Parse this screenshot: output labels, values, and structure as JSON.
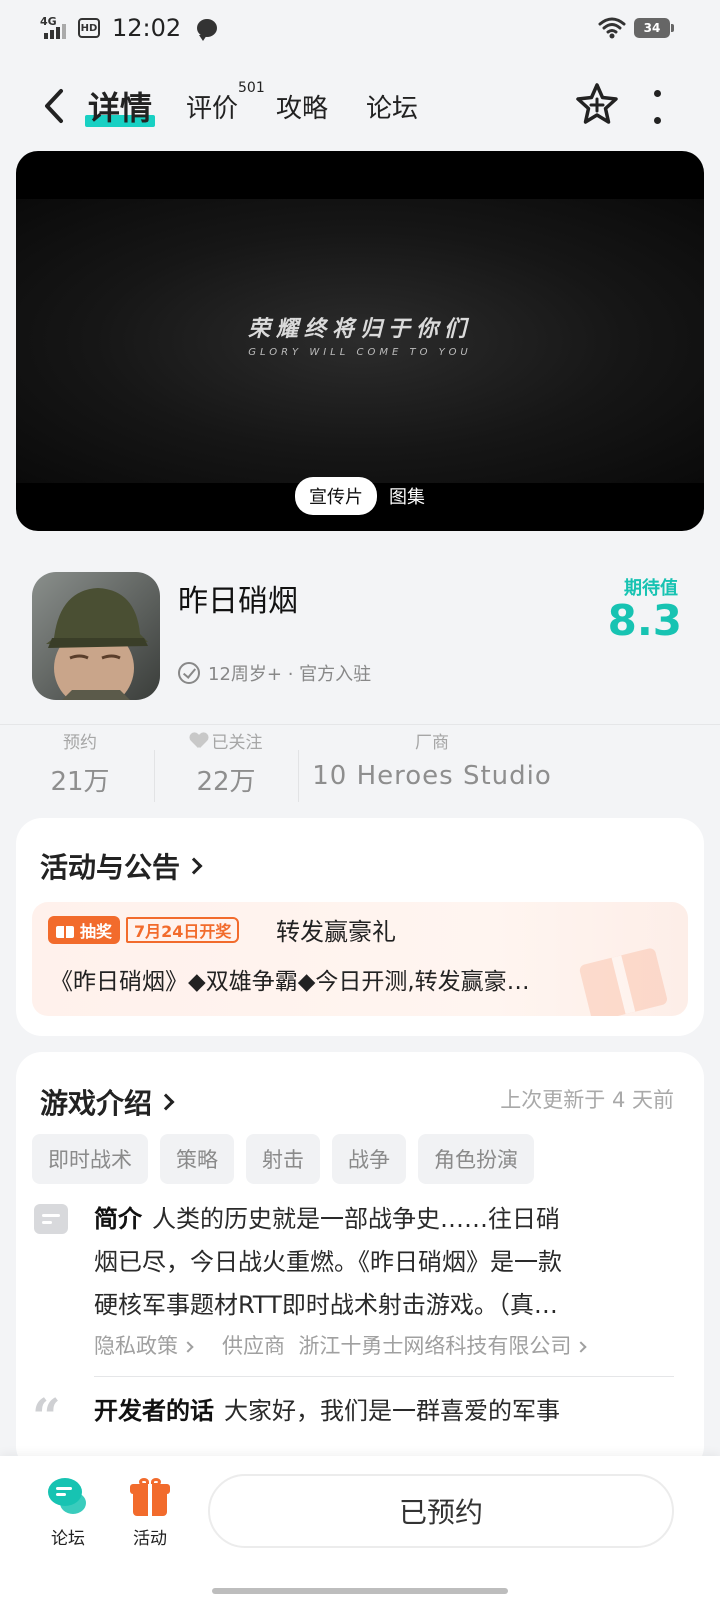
{
  "status_bar": {
    "network": "4G",
    "hd": "HD",
    "time": "12:02",
    "battery": "34"
  },
  "nav": {
    "tabs": [
      {
        "label": "详情",
        "active": true
      },
      {
        "label": "评价",
        "badge": "501"
      },
      {
        "label": "攻略"
      },
      {
        "label": "论坛"
      }
    ]
  },
  "hero": {
    "slogan": "荣耀终将归于你们",
    "slogan_en": "GLORY WILL COME TO YOU",
    "tabs": [
      "宣传片",
      "图集"
    ]
  },
  "app": {
    "name": "昨日硝烟",
    "meta": "12周岁+ · 官方入驻",
    "expect_label": "期待值",
    "expect_value": "8.3"
  },
  "stats": {
    "reserve": {
      "label": "预约",
      "value": "21万"
    },
    "follow": {
      "label": "已关注",
      "value": "22万"
    },
    "vendor": {
      "label": "厂商",
      "value": "10 Heroes Studio"
    }
  },
  "activity": {
    "title": "活动与公告",
    "tag": "抽奖",
    "date": "7月24日开奖",
    "headline": "转发赢豪礼",
    "body": "《昨日硝烟》◆双雄争霸◆今日开测,转发赢豪…"
  },
  "intro": {
    "title": "游戏介绍",
    "update_note": "上次更新于 4 天前",
    "tags": [
      "即时战术",
      "策略",
      "射击",
      "战争",
      "角色扮演"
    ],
    "summary_label": "简介",
    "summary_line1": "人类的历史就是一部战争史……往日硝",
    "summary_line2": "烟已尽，今日战火重燃。《昨日硝烟》是一款",
    "summary_line3": "硬核军事题材RTT即时战术射击游戏。（真…",
    "privacy_link": "隐私政策",
    "supplier_label": "供应商",
    "supplier_name": "浙江十勇士网络科技有限公司",
    "dev_label": "开发者的话",
    "dev_text": "大家好，我们是一群喜爱的军事"
  },
  "bottom": {
    "forum": "论坛",
    "activity": "活动",
    "reserve_button": "已预约"
  },
  "colors": {
    "accent": "#17c3b2",
    "orange": "#f26b2c"
  }
}
